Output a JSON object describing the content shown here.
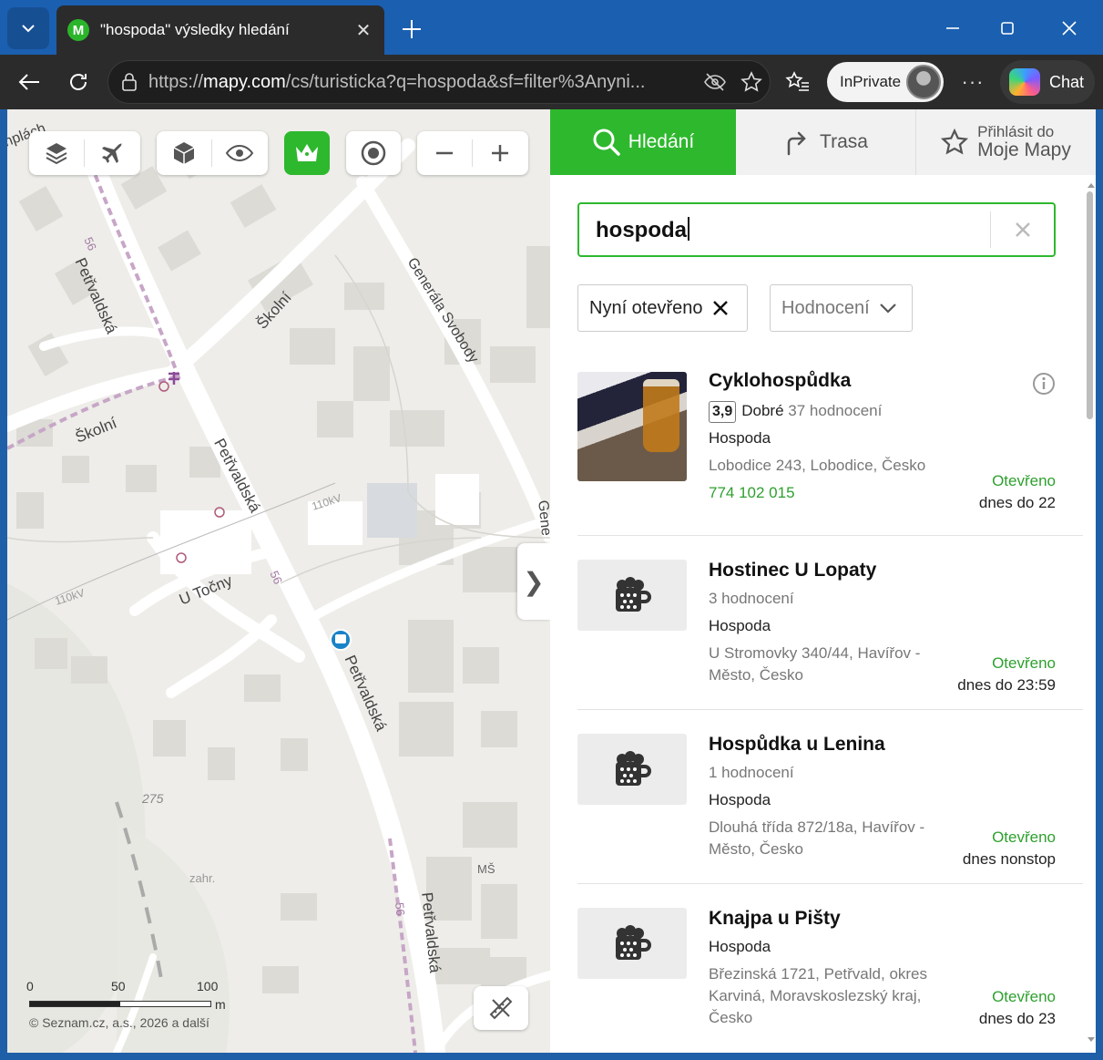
{
  "browser": {
    "tab_title": "\"hospoda\" výsledky hledání",
    "favicon_letter": "M",
    "url_prefix": "https://",
    "url_host": "mapy.com",
    "url_path": "/cs/turisticka?q=hospoda&sf=filter%3Anyni...",
    "inprivate_label": "InPrivate",
    "chat_label": "Chat"
  },
  "map": {
    "street_labels": [
      "Petřvaldská",
      "Školní",
      "Generála Svobody",
      "U Točny",
      "Petřvaldská",
      "Školní",
      "Petřvaldská",
      "Petřvaldská",
      "Gene"
    ],
    "other_labels": {
      "power1": "110kV",
      "power2": "110kV",
      "road_num1": "56",
      "road_num2": "56",
      "road_num3": "56",
      "elevation": "275",
      "garden": "zahr.",
      "school": "MŠ",
      "top_left": "nplách"
    },
    "scale": {
      "l0": "0",
      "l50": "50",
      "l100": "100",
      "unit": "m"
    },
    "copyright": "© Seznam.cz, a.s., 2026 a další"
  },
  "sidebar": {
    "tabs": {
      "search": "Hledání",
      "route": "Trasa",
      "login_line1": "Přihlásit do",
      "login_line2": "Moje Mapy"
    },
    "search": {
      "value": "hospoda"
    },
    "filters": {
      "open_now": "Nyní otevřeno",
      "rating": "Hodnocení"
    },
    "results": [
      {
        "name": "Cyklohospůdka",
        "rating": "3,9",
        "rating_word": "Dobré",
        "reviews": "37 hodnocení",
        "category": "Hospoda",
        "address": "Lobodice 243, Lobodice, Česko",
        "phone": "774 102 015",
        "status": "Otevřeno",
        "hours": "dnes do 22"
      },
      {
        "name": "Hostinec U Lopaty",
        "reviews": "3 hodnocení",
        "category": "Hospoda",
        "address": "U Stromovky 340/44, Havířov - Město, Česko",
        "status": "Otevřeno",
        "hours": "dnes do 23:59"
      },
      {
        "name": "Hospůdka u Lenina",
        "reviews": "1 hodnocení",
        "category": "Hospoda",
        "address": "Dlouhá třída 872/18a, Havířov - Město, Česko",
        "status": "Otevřeno",
        "hours": "dnes nonstop"
      },
      {
        "name": "Knajpa u Pišty",
        "category": "Hospoda",
        "address": "Březinská 1721, Petřvald, okres Karviná, Moravskoslezský kraj, Česko",
        "status": "Otevřeno",
        "hours": "dnes do 23"
      }
    ]
  },
  "colors": {
    "brand_green": "#2eb82e",
    "open_green": "#2ea02e",
    "titlebar_blue": "#1b5fb0"
  }
}
